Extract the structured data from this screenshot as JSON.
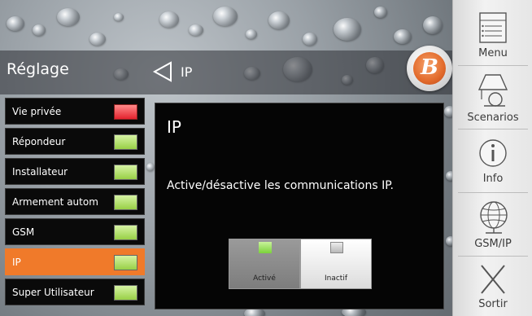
{
  "header": {
    "title": "Réglage",
    "breadcrumb": "IP"
  },
  "settings_list": [
    {
      "label": "Vie privée",
      "state": "red"
    },
    {
      "label": "Répondeur",
      "state": "green"
    },
    {
      "label": "Installateur",
      "state": "green"
    },
    {
      "label": "Armement autom",
      "state": "green"
    },
    {
      "label": "GSM",
      "state": "green"
    },
    {
      "label": "IP",
      "state": "green",
      "selected": true
    },
    {
      "label": "Super Utilisateur",
      "state": "green"
    }
  ],
  "dialog": {
    "title": "IP",
    "description": "Active/désactive les communications IP.",
    "buttons": {
      "active_label": "Activé",
      "inactive_label": "Inactif"
    }
  },
  "sidebar": {
    "menu": "Menu",
    "scenarios": "Scenarios",
    "info": "Info",
    "gsm_ip": "GSM/IP",
    "exit": "Sortir"
  },
  "colors": {
    "accent_orange": "#f07a2a",
    "led_green": "#98d046",
    "led_red": "#e3222e"
  },
  "icons": {
    "back": "back-arrow-icon",
    "logo": "brand-logo-icon",
    "menu": "menu-icon",
    "scenarios": "scenarios-icon",
    "info": "info-icon",
    "gsm_ip": "globe-icon",
    "exit": "close-icon"
  }
}
